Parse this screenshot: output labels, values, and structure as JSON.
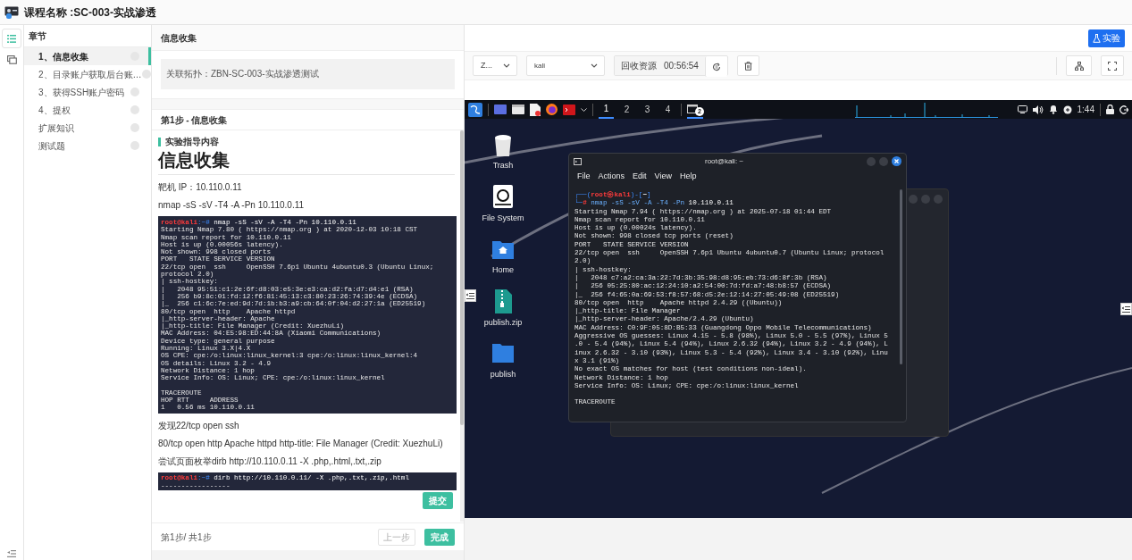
{
  "header": {
    "title": "课程名称 :SC-003-实战渗透"
  },
  "sidebar": {
    "title": "章节",
    "items": [
      {
        "label": "1、信息收集",
        "selected": true
      },
      {
        "label": "2、目录账户获取后台账…",
        "selected": false
      },
      {
        "label": "3、获得SSH账户密码",
        "selected": false
      },
      {
        "label": "4、提权",
        "selected": false
      },
      {
        "label": "扩展知识",
        "selected": false
      },
      {
        "label": "测试题",
        "selected": false
      }
    ]
  },
  "content": {
    "title": "信息收集",
    "topology": "关联拓扑：ZBN-SC-003-实战渗透测试",
    "step_title": "第1步 - 信息收集",
    "section_label": "实验指导内容",
    "heading": "信息收集",
    "blocks": [
      {
        "kind": "text",
        "text": "靶机 IP：10.110.0.11"
      },
      {
        "kind": "text",
        "text": "nmap -sS -sV -T4 -A -Pn 10.110.0.11"
      },
      {
        "kind": "terminal",
        "prompt_lines": [
          [
            {
              "kind": "user",
              "text": "root@kali"
            },
            {
              "kind": "frame",
              "text": ":~#"
            },
            {
              "kind": "arg",
              "text": " nmap -sS -sV -A -T4 -Pn 10.110.0.11"
            }
          ]
        ],
        "lines": [
          "Starting Nmap 7.80 ( https://nmap.org ) at 2020-12-03 10:18 CST",
          "Nmap scan report for 10.110.0.11",
          "Host is up (0.00056s latency).",
          "Not shown: 998 closed ports",
          "PORT   STATE SERVICE VERSION",
          "22/tcp open  ssh     OpenSSH 7.6p1 Ubuntu 4ubuntu0.3 (Ubuntu Linux; protocol 2.0)",
          "| ssh-hostkey:",
          "|   2048 95:51:c1:2e:6f:d8:03:e5:3e:e3:ca:d2:fa:d7:d4:e1 (RSA)",
          "|   256 b9:8c:01:fd:12:f6:81:45:13:c3:80:23:26:74:39:4e (ECDSA)",
          "|_  256 c1:6c:7e:ed:9d:7d:1b:b3:a9:cb:64:0f:04:d2:27:1a (ED25519)",
          "80/tcp open  http    Apache httpd",
          "|_http-server-header: Apache",
          "|_http-title: File Manager (Credit: XuezhuLi)",
          "MAC Address: 04:E5:98:ED:44:8A (Xiaomi Communications)",
          "Device type: general purpose",
          "Running: Linux 3.X|4.X",
          "OS CPE: cpe:/o:linux:linux_kernel:3 cpe:/o:linux:linux_kernel:4",
          "OS details: Linux 3.2 - 4.9",
          "Network Distance: 1 hop",
          "Service Info: OS: Linux; CPE: cpe:/o:linux:linux_kernel"
        ],
        "lines_after_gap": [
          "TRACEROUTE",
          "HOP RTT     ADDRESS",
          "1   0.56 ms 10.110.0.11"
        ]
      },
      {
        "kind": "text",
        "text": "发现22/tcp open ssh"
      },
      {
        "kind": "text",
        "text": "80/tcp open http Apache httpd http-title: File Manager (Credit: XuezhuLi)"
      },
      {
        "kind": "text",
        "text": "尝试页面枚举dirb http://10.110.0.11 -X .php,.html,.txt,.zip"
      },
      {
        "kind": "terminal_strip",
        "prompt_lines": [
          [
            {
              "kind": "user",
              "text": "root@kali"
            },
            {
              "kind": "frame",
              "text": ":~#"
            },
            {
              "kind": "arg",
              "text": " dirb http://10.110.0.11/ -X .php,.txt,.zip,.html"
            }
          ]
        ],
        "lines": [
          "-----------------"
        ]
      }
    ],
    "submit": "提交",
    "pager": "第1步/ 共1步",
    "prev": "上一步",
    "done": "完成"
  },
  "lab": {
    "experiment": "实验",
    "toolbar": {
      "zone": "Z...",
      "machine": "kali",
      "reclaim": "回收资源",
      "timer": "00:56:54"
    },
    "desktop": {
      "workspaces": [
        {
          "label": "1",
          "selected": true
        },
        {
          "label": "2",
          "selected": false
        },
        {
          "label": "3",
          "selected": false
        },
        {
          "label": "4",
          "selected": false
        }
      ],
      "window_badge": "2",
      "clock": "1:44",
      "icons": [
        {
          "kind": "trash",
          "label": "Trash"
        },
        {
          "kind": "drive",
          "label": "File System"
        },
        {
          "kind": "home",
          "label": "Home"
        },
        {
          "kind": "zip",
          "label": "publish.zip"
        },
        {
          "kind": "folder",
          "label": "publish"
        }
      ],
      "terminal": {
        "title": "root@kali: ~",
        "menu": [
          "File",
          "Actions",
          "Edit",
          "View",
          "Help"
        ],
        "prompt_lines": [
          [
            {
              "kind": "frame",
              "text": "┌──("
            },
            {
              "kind": "user",
              "text": "root㉿kali"
            },
            {
              "kind": "frame",
              "text": ")-["
            },
            {
              "kind": "path",
              "text": "~"
            },
            {
              "kind": "frame",
              "text": "]"
            }
          ],
          [
            {
              "kind": "frame",
              "text": "└─"
            },
            {
              "kind": "user",
              "text": "#"
            },
            {
              "kind": "cmd",
              "text": " nmap -sS -sV -A -T4 -Pn"
            },
            {
              "kind": "arg",
              "text": " 10.110.0.11"
            }
          ]
        ],
        "lines": [
          "Starting Nmap 7.94 ( https://nmap.org ) at 2025-07-18 01:44 EDT",
          "Nmap scan report for 10.110.0.11",
          "Host is up (0.00024s latency).",
          "Not shown: 998 closed tcp ports (reset)",
          "PORT   STATE SERVICE VERSION",
          "22/tcp open  ssh     OpenSSH 7.6p1 Ubuntu 4ubuntu0.7 (Ubuntu Linux; protocol",
          "2.0)",
          "| ssh-hostkey:",
          "|   2048 c7:a2:ca:3a:22:7d:3b:35:98:d8:95:eb:73:d6:8f:3b (RSA)",
          "|   256 05:25:80:ac:12:24:10:a2:54:00:7d:fd:a7:48:b8:57 (ECDSA)",
          "|_  256 f4:65:0a:69:53:f8:57:68:d5:2e:12:14:27:05:49:08 (ED25519)",
          "80/tcp open  http    Apache httpd 2.4.29 ((Ubuntu))",
          "|_http-title: File Manager",
          "|_http-server-header: Apache/2.4.29 (Ubuntu)",
          "MAC Address: C0:9F:05:8D:B5:33 (Guangdong Oppo Mobile Telecommunications)",
          "Aggressive OS guesses: Linux 4.15 - 5.8 (98%), Linux 5.0 - 5.5 (97%), Linux 5",
          ".0 - 5.4 (94%), Linux 5.4 (94%), Linux 2.6.32 (94%), Linux 3.2 - 4.9 (94%), L",
          "inux 2.6.32 - 3.10 (93%), Linux 5.3 - 5.4 (92%), Linux 3.4 - 3.10 (92%), Linu",
          "x 3.1 (91%)",
          "No exact OS matches for host (test conditions non-ideal).",
          "Network Distance: 1 hop",
          "Service Info: OS: Linux; CPE: cpe:/o:linux:linux_kernel"
        ],
        "lines_after_gap": [
          "TRACEROUTE"
        ]
      }
    }
  }
}
